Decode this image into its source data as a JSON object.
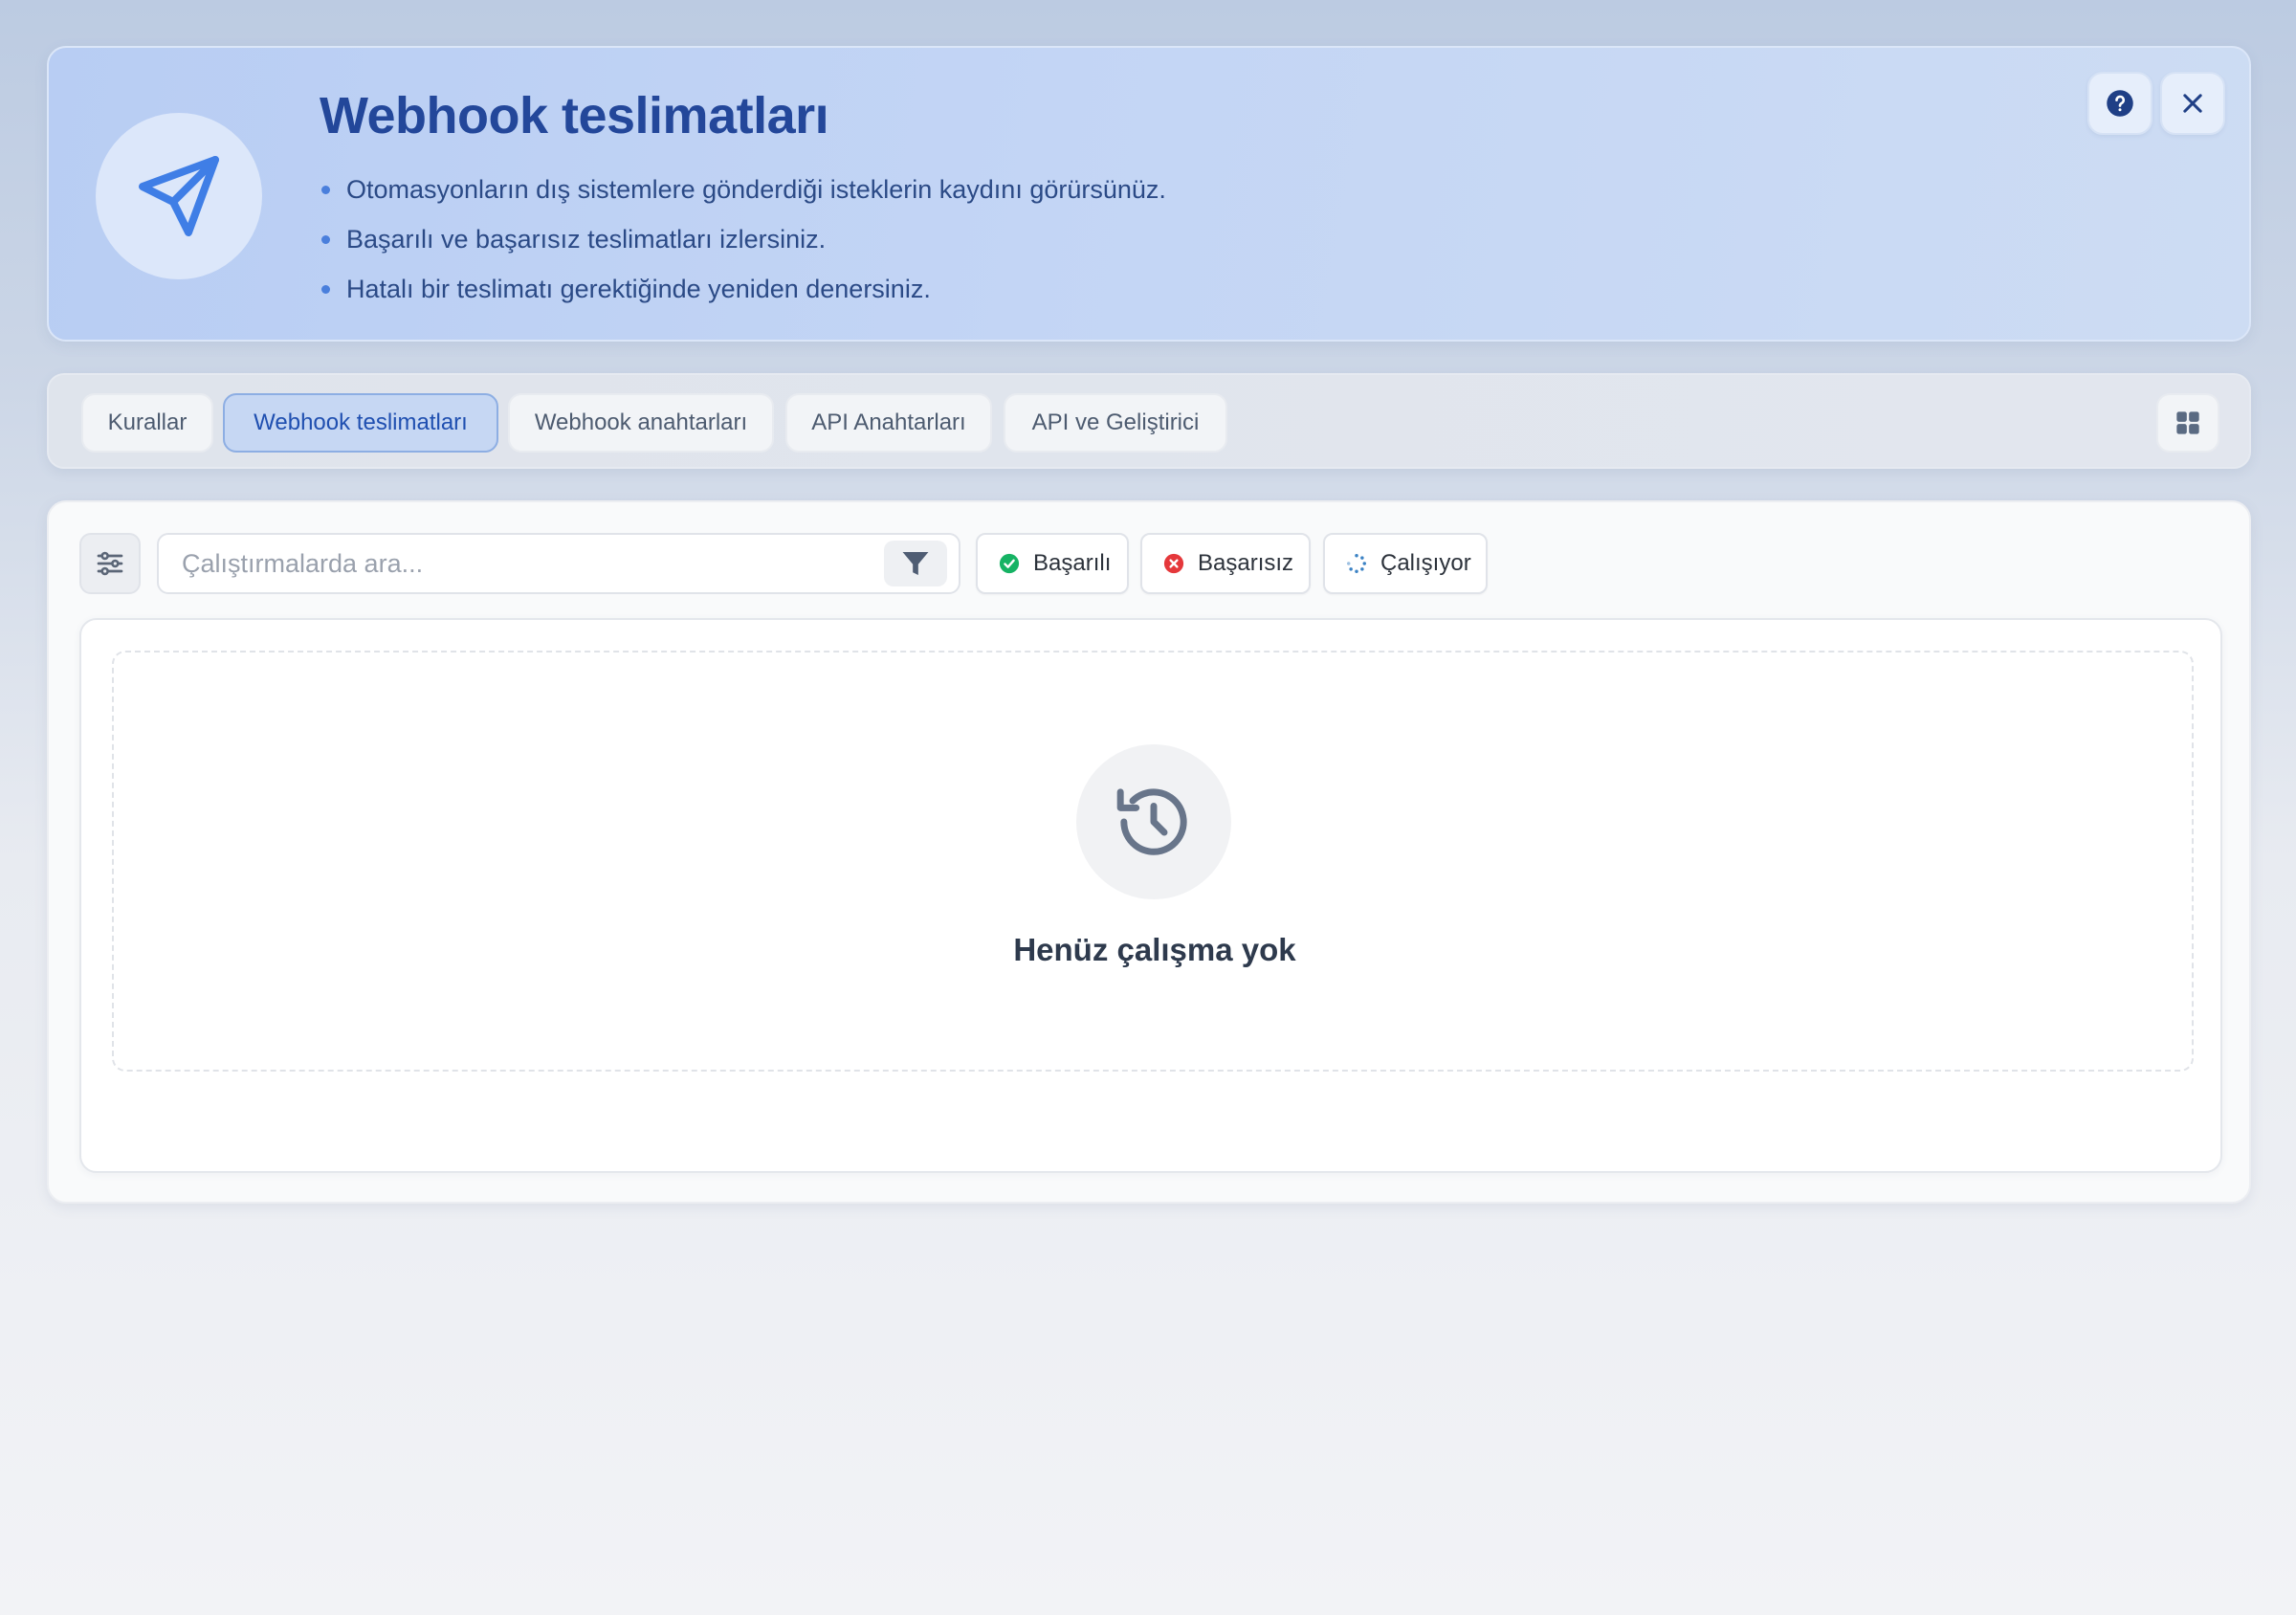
{
  "header": {
    "title": "Webhook teslimatları",
    "bullets": [
      "Otomasyonların dış sistemlere gönderdiği isteklerin kaydını görürsünüz.",
      "Başarılı ve başarısız teslimatları izlersiniz.",
      "Hatalı bir teslimatı gerektiğinde yeniden denersiniz."
    ],
    "emblem_icon": "send-paper-plane-icon",
    "help_icon": "help-circle-icon",
    "close_icon": "close-icon"
  },
  "tabs": [
    {
      "label": "Kurallar",
      "active": false
    },
    {
      "label": "Webhook teslimatları",
      "active": true
    },
    {
      "label": "Webhook anahtarları",
      "active": false
    },
    {
      "label": "API Anahtarları",
      "active": false
    },
    {
      "label": "API ve Geliştirici",
      "active": false
    }
  ],
  "toolbar": {
    "settings_icon": "sliders-icon",
    "search_placeholder": "Çalıştırmalarda ara...",
    "search_value": "",
    "filter_icon": "filter-icon",
    "status_filters": [
      {
        "label": "Başarılı",
        "icon": "check-circle-icon",
        "color": "#16b364"
      },
      {
        "label": "Başarısız",
        "icon": "x-circle-icon",
        "color": "#e5383b"
      },
      {
        "label": "Çalışıyor",
        "icon": "spinner-icon",
        "color": "#3b82c4"
      }
    ]
  },
  "empty_state": {
    "icon": "history-icon",
    "message": "Henüz çalışma yok"
  },
  "colors": {
    "accent": "#2f6fdd",
    "title": "#23479a",
    "active_tab_bg": "#c6d7f3"
  }
}
